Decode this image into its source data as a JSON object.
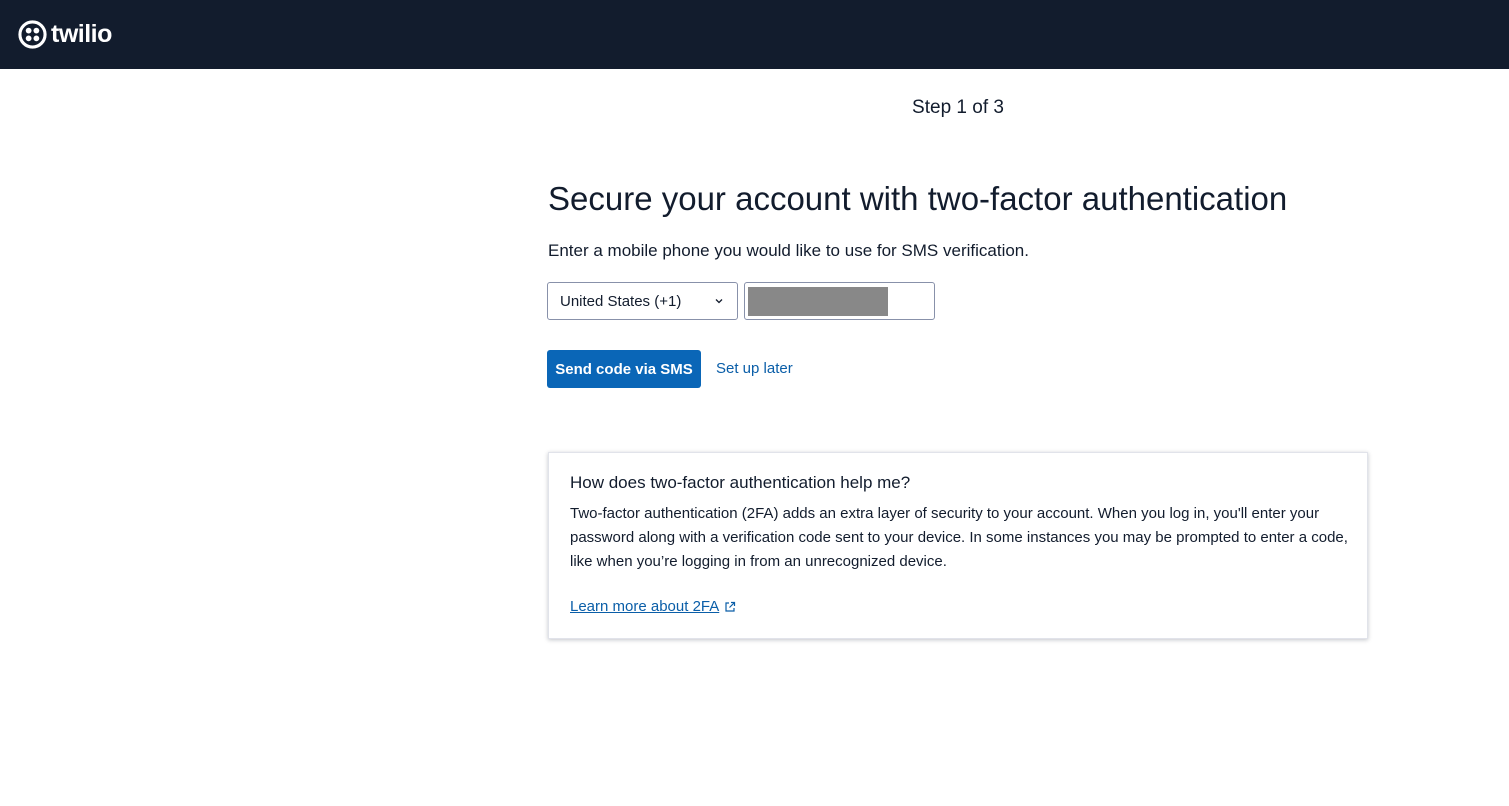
{
  "header": {
    "logo_text": "twilio",
    "logo_icon": "twilio-logo-icon",
    "background_color": "#121c2d"
  },
  "step_indicator": "Step 1 of 3",
  "main": {
    "title": "Secure your account with two-factor authentication",
    "instructions": "Enter a mobile phone you would like to use for SMS verification.",
    "country_select": {
      "selected": "United States (+1)",
      "icon": "chevron-down-icon"
    },
    "phone_input": {
      "value": ""
    },
    "send_button_label": "Send code via SMS",
    "setup_later_label": "Set up later",
    "primary_color": "#0a66b7",
    "link_color": "#0a5ea8"
  },
  "info_card": {
    "title": "How does two-factor authentication help me?",
    "body": "Two-factor authentication (2FA) adds an extra layer of security to your account. When you log in, you'll enter your password along with a verification code sent to your device. In some instances you may be prompted to enter a code, like when you’re logging in from an unrecognized device.",
    "link_label": "Learn more about 2FA",
    "link_icon": "external-link-icon"
  }
}
